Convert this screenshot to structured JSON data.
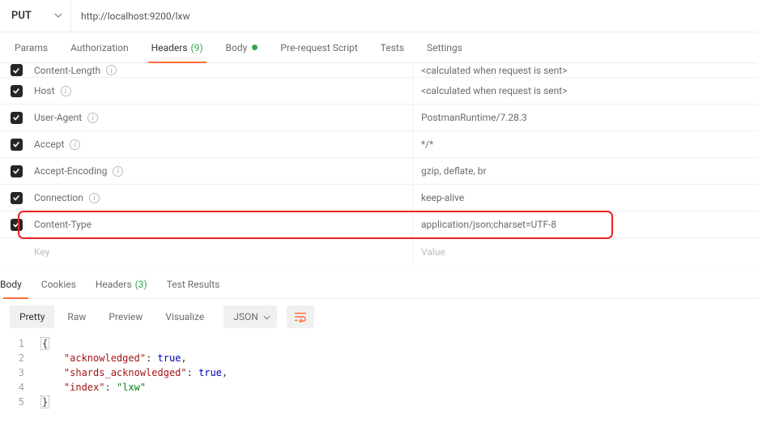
{
  "request": {
    "method": "PUT",
    "url": "http://localhost:9200/lxw"
  },
  "req_tabs": {
    "params": "Params",
    "auth": "Authorization",
    "headers": "Headers",
    "headers_count": "(9)",
    "body": "Body",
    "prerequest": "Pre-request Script",
    "tests": "Tests",
    "settings": "Settings"
  },
  "headers_rows": [
    {
      "key": "Content-Length",
      "value": "<calculated when request is sent>",
      "info": true,
      "checked": true
    },
    {
      "key": "Host",
      "value": "<calculated when request is sent>",
      "info": true,
      "checked": true
    },
    {
      "key": "User-Agent",
      "value": "PostmanRuntime/7.28.3",
      "info": true,
      "checked": true
    },
    {
      "key": "Accept",
      "value": "*/*",
      "info": true,
      "checked": true
    },
    {
      "key": "Accept-Encoding",
      "value": "gzip, deflate, br",
      "info": true,
      "checked": true
    },
    {
      "key": "Connection",
      "value": "keep-alive",
      "info": true,
      "checked": true
    },
    {
      "key": "Content-Type",
      "value": "application/json;charset=UTF-8",
      "info": false,
      "checked": true
    }
  ],
  "headers_placeholder": {
    "key": "Key",
    "value": "Value"
  },
  "resp_tabs": {
    "body": "Body",
    "cookies": "Cookies",
    "headers": "Headers",
    "headers_count": "(3)",
    "tests": "Test Results"
  },
  "view": {
    "pretty": "Pretty",
    "raw": "Raw",
    "preview": "Preview",
    "visualize": "Visualize",
    "format": "JSON"
  },
  "code": {
    "l1": "{",
    "l2_key": "\"acknowledged\"",
    "l2_val": "true",
    "l3_key": "\"shards_acknowledged\"",
    "l3_val": "true",
    "l4_key": "\"index\"",
    "l4_val": "\"lxw\"",
    "l5": "}"
  }
}
